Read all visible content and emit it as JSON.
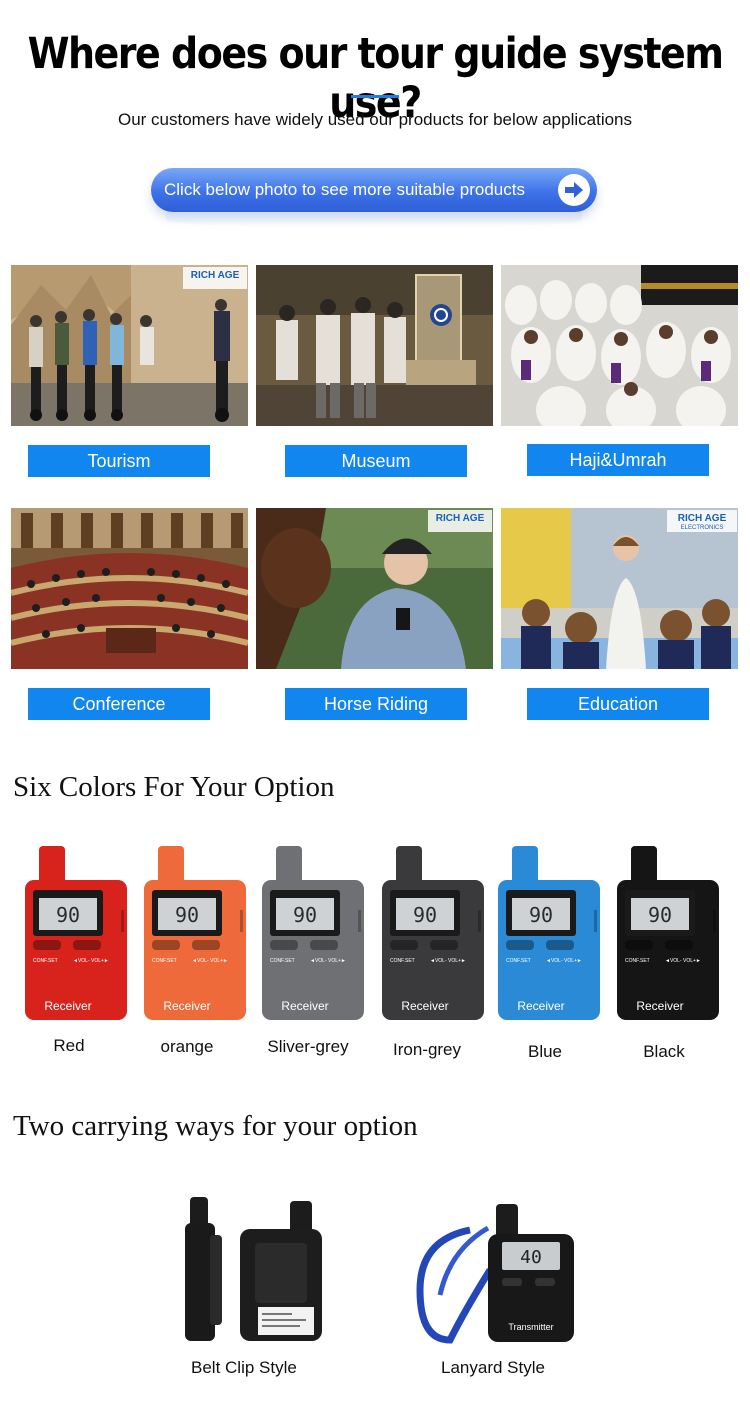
{
  "header": {
    "title": "Where does our tour guide system use?",
    "subtitle": "Our customers have widely used our products for below applications"
  },
  "cta": {
    "label": "Click below photo to see more suitable products",
    "icon": "arrow-right-icon"
  },
  "applications": [
    {
      "label": "Tourism"
    },
    {
      "label": "Museum"
    },
    {
      "label": "Haji&Umrah"
    },
    {
      "label": "Conference"
    },
    {
      "label": "Horse Riding"
    },
    {
      "label": "Education"
    }
  ],
  "watermark": {
    "brand": "RICH AGE",
    "sub": "ELECTRONICS"
  },
  "colors_section": {
    "title": "Six Colors For Your Option",
    "device_screen": "90",
    "device_text": "Receiver",
    "device_buttons": "CONF.SET",
    "device_volume": "◄VOL- VOL+►",
    "items": [
      {
        "label": "Red",
        "color": "#d8231c"
      },
      {
        "label": "orange",
        "color": "#ee6a3a"
      },
      {
        "label": "Sliver-grey",
        "color": "#6f7074"
      },
      {
        "label": "Iron-grey",
        "color": "#3a3a3c"
      },
      {
        "label": "Blue",
        "color": "#2a8ad6"
      },
      {
        "label": "Black",
        "color": "#151515"
      }
    ]
  },
  "carry_section": {
    "title": "Two carrying ways for your option",
    "items": [
      {
        "label": "Belt Clip Style"
      },
      {
        "label": "Lanyard Style",
        "device_text": "Transmitter",
        "screen": "40"
      }
    ]
  },
  "accent_color": "#1186ee"
}
